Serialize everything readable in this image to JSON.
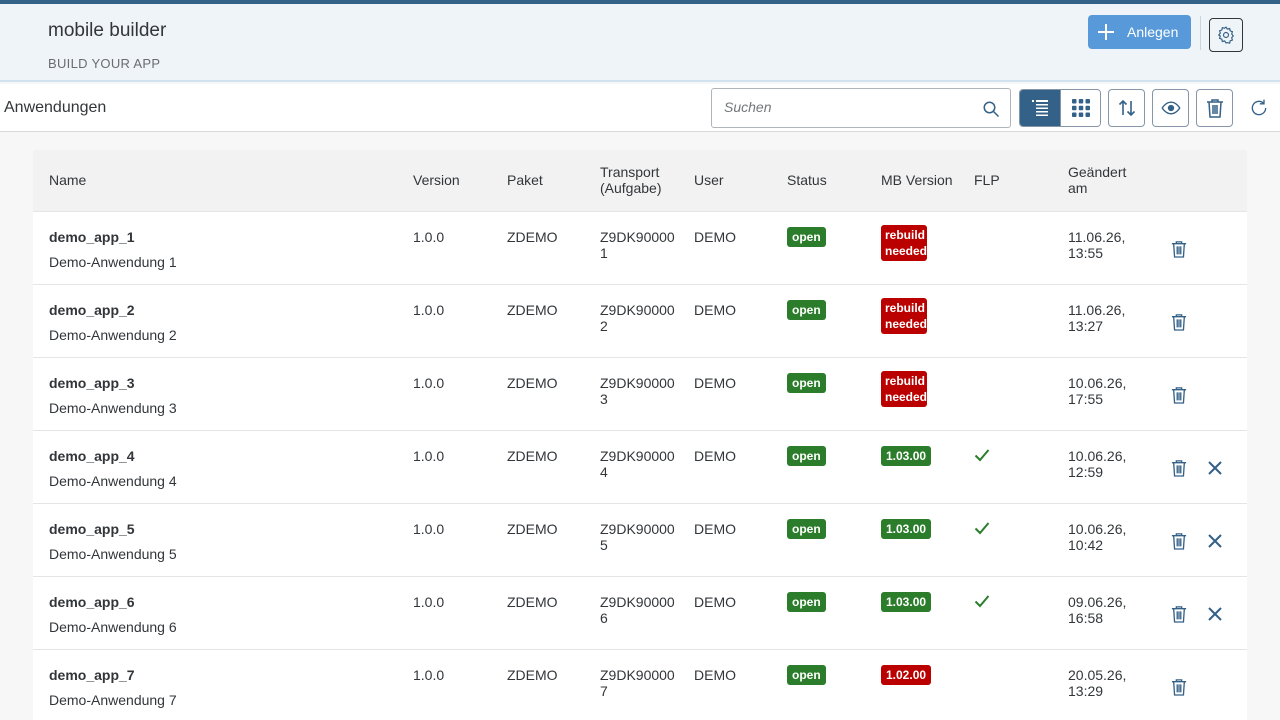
{
  "shell": {
    "app_title": "mobile builder",
    "app_subtitle": "BUILD YOUR APP",
    "create_label": "Anlegen"
  },
  "toolbar": {
    "title": "Anwendungen",
    "search_placeholder": "Suchen"
  },
  "columns": {
    "name": "Name",
    "version": "Version",
    "package": "Paket",
    "transport": "Transport (Aufgabe)",
    "user": "User",
    "status": "Status",
    "mb_version": "MB Version",
    "flp": "FLP",
    "changed": "Geändert am"
  },
  "colors": {
    "brand": "#346187",
    "create_button": "#5899da",
    "status_ok": "#2b7d2b",
    "status_error": "#bb0000"
  },
  "rows": [
    {
      "name": "demo_app_1",
      "desc": "Demo-Anwendung 1",
      "version": "1.0.0",
      "package": "ZDEMO",
      "transport": "Z9DK900001",
      "user": "DEMO",
      "status": "open",
      "mb_version": "rebuild needed",
      "mb_state": "red",
      "flp": false,
      "changed": "11.06.26, 13:55",
      "deletable": true,
      "removable": false
    },
    {
      "name": "demo_app_2",
      "desc": "Demo-Anwendung 2",
      "version": "1.0.0",
      "package": "ZDEMO",
      "transport": "Z9DK900002",
      "user": "DEMO",
      "status": "open",
      "mb_version": "rebuild needed",
      "mb_state": "red",
      "flp": false,
      "changed": "11.06.26, 13:27",
      "deletable": true,
      "removable": false
    },
    {
      "name": "demo_app_3",
      "desc": "Demo-Anwendung 3",
      "version": "1.0.0",
      "package": "ZDEMO",
      "transport": "Z9DK900003",
      "user": "DEMO",
      "status": "open",
      "mb_version": "rebuild needed",
      "mb_state": "red",
      "flp": false,
      "changed": "10.06.26, 17:55",
      "deletable": true,
      "removable": false
    },
    {
      "name": "demo_app_4",
      "desc": "Demo-Anwendung 4",
      "version": "1.0.0",
      "package": "ZDEMO",
      "transport": "Z9DK900004",
      "user": "DEMO",
      "status": "open",
      "mb_version": "1.03.00",
      "mb_state": "green",
      "flp": true,
      "changed": "10.06.26, 12:59",
      "deletable": true,
      "removable": true
    },
    {
      "name": "demo_app_5",
      "desc": "Demo-Anwendung 5",
      "version": "1.0.0",
      "package": "ZDEMO",
      "transport": "Z9DK900005",
      "user": "DEMO",
      "status": "open",
      "mb_version": "1.03.00",
      "mb_state": "green",
      "flp": true,
      "changed": "10.06.26, 10:42",
      "deletable": true,
      "removable": true
    },
    {
      "name": "demo_app_6",
      "desc": "Demo-Anwendung 6",
      "version": "1.0.0",
      "package": "ZDEMO",
      "transport": "Z9DK900006",
      "user": "DEMO",
      "status": "open",
      "mb_version": "1.03.00",
      "mb_state": "green",
      "flp": true,
      "changed": "09.06.26, 16:58",
      "deletable": true,
      "removable": true
    },
    {
      "name": "demo_app_7",
      "desc": "Demo-Anwendung 7",
      "version": "1.0.0",
      "package": "ZDEMO",
      "transport": "Z9DK900007",
      "user": "DEMO",
      "status": "open",
      "mb_version": "1.02.00",
      "mb_state": "red",
      "flp": false,
      "changed": "20.05.26, 13:29",
      "deletable": true,
      "removable": false
    }
  ]
}
